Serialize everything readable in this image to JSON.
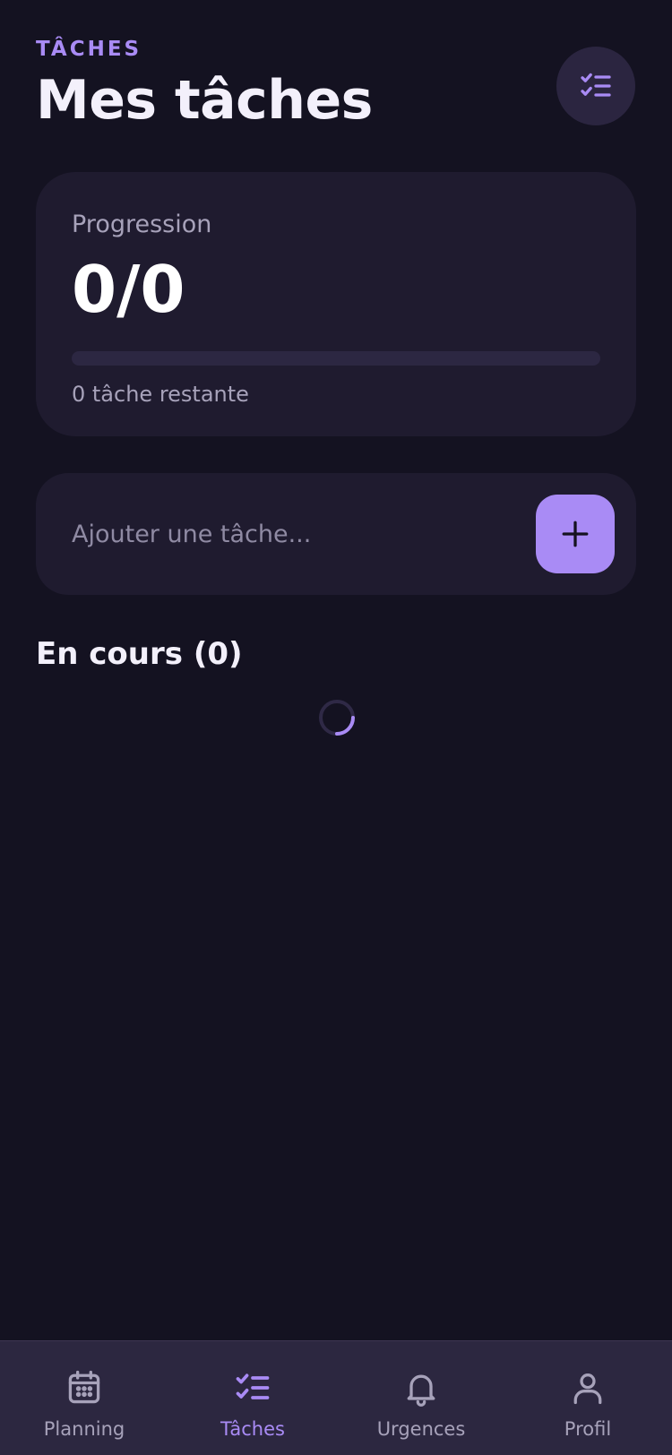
{
  "header": {
    "eyebrow": "TÂCHES",
    "title": "Mes tâches",
    "action_icon": "checklist-icon"
  },
  "progress": {
    "label": "Progression",
    "value": "0/0",
    "fraction": 0,
    "remaining_text": "0 tâche restante"
  },
  "add_task": {
    "placeholder": "Ajouter une tâche...",
    "value": "",
    "button_icon": "plus-icon"
  },
  "section": {
    "title": "En cours (0)",
    "loading": true
  },
  "tabbar": {
    "items": [
      {
        "label": "Planning",
        "icon": "calendar-icon",
        "active": false
      },
      {
        "label": "Tâches",
        "icon": "checklist-icon",
        "active": true
      },
      {
        "label": "Urgences",
        "icon": "bell-icon",
        "active": false
      },
      {
        "label": "Profil",
        "icon": "user-icon",
        "active": false
      }
    ]
  },
  "colors": {
    "background": "#141221",
    "card": "#1f1b2f",
    "accent": "#a98bf5",
    "muted_text": "#a7a2ba",
    "tabbar": "#2c2740"
  }
}
